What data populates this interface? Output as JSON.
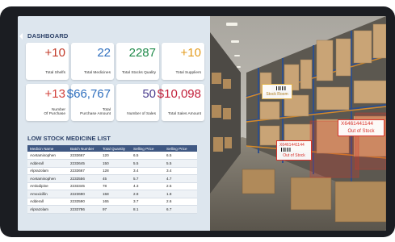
{
  "dashboard": {
    "title": "DASHBOARD",
    "kpis": [
      {
        "value": "+10",
        "label": [
          "Total Shelfs"
        ],
        "color": "#c23b2a"
      },
      {
        "value": "22",
        "label": [
          "Total Medicines"
        ],
        "color": "#2f6fbe"
      },
      {
        "value": "2287",
        "label": [
          "Total Stocks Quality"
        ],
        "color": "#1f8a4a"
      },
      {
        "value": "+10",
        "label": [
          "Total Suppliers"
        ],
        "color": "#e39b1c"
      },
      {
        "value": "+13",
        "label": [
          "Number",
          "Of Purchase"
        ],
        "color": "#d2413a"
      },
      {
        "value": "$66,767",
        "label": [
          "Total",
          "Purchase Amount"
        ],
        "color": "#2f6fbe"
      },
      {
        "value": "50",
        "label": [
          "Number of Sales"
        ],
        "color": "#4a3d8f"
      },
      {
        "value": "$10,098",
        "label": [
          "Total Sales Amount"
        ],
        "color": "#c2203a"
      }
    ],
    "low_stock": {
      "title": "LOW STOCK MEDICINE LIST",
      "columns": [
        "Medicin Name",
        "Batch Number",
        "Total Quantity",
        "Selling Price",
        "Selling Price"
      ],
      "rows": [
        [
          "Acetaminophen",
          "2233667",
          "120",
          "6.5",
          "6.5"
        ],
        [
          "Adderall",
          "2233645",
          "150",
          "5.5",
          "5.5"
        ],
        [
          "Alprazolam",
          "2233667",
          "128",
          "3.4",
          "3.4"
        ],
        [
          "Acetaminophen",
          "2233556",
          "45",
          "5.7",
          "4.7"
        ],
        [
          "Amlodipine",
          "2233345",
          "78",
          "4.3",
          "2.5"
        ],
        [
          "Amoxicillin",
          "2223690",
          "158",
          "2.8",
          "1.8"
        ],
        [
          "Adderall",
          "2233590",
          "165",
          "3.7",
          "2.6"
        ],
        [
          "Alprazolam",
          "2233786",
          "97",
          "8.1",
          "6.7"
        ]
      ]
    }
  },
  "warehouse": {
    "tags": [
      {
        "code": "",
        "status": "Stock Room",
        "color": "#e0b24a"
      },
      {
        "code": "X6461441144",
        "status": "Out of Stock",
        "color": "#d9322a"
      },
      {
        "code": "X6461441144",
        "status": "Out of Stock",
        "color": "#d9322a"
      }
    ]
  }
}
